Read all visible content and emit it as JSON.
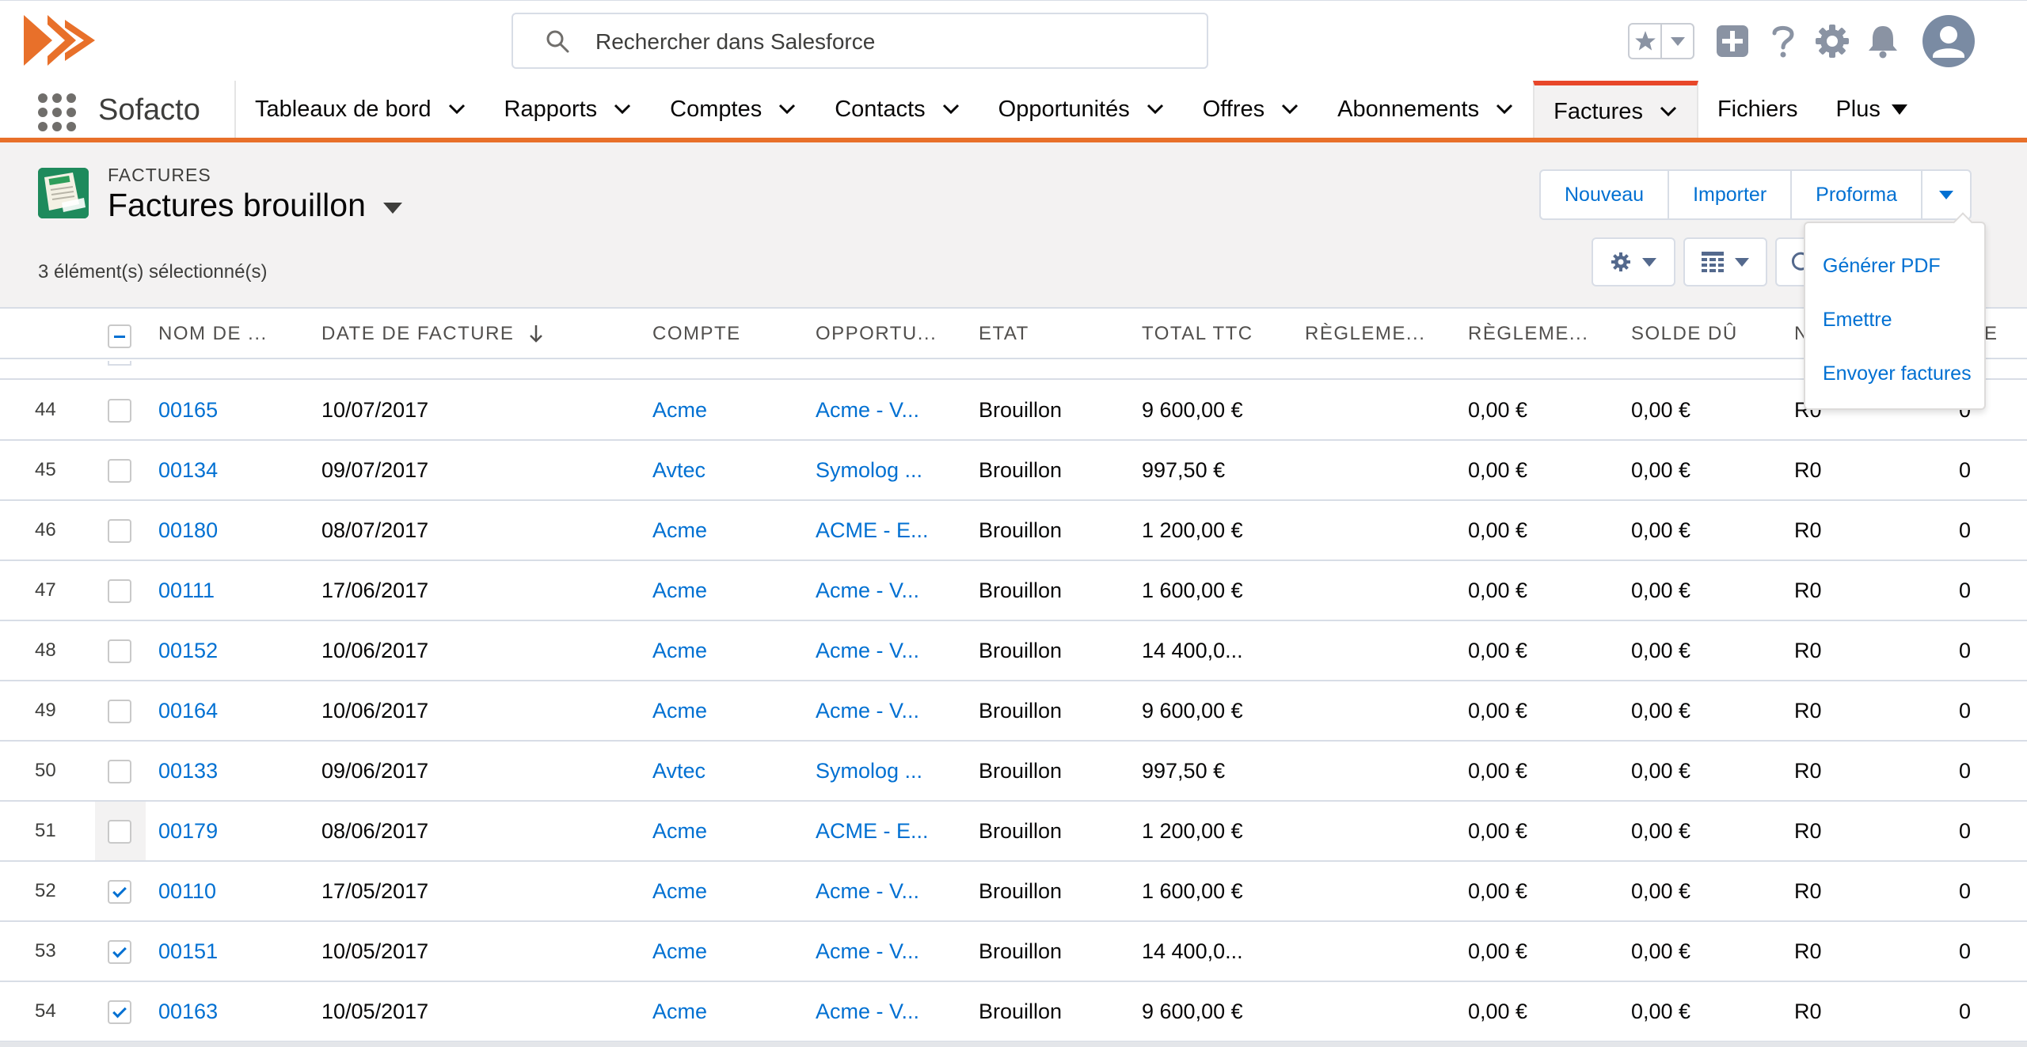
{
  "header": {
    "search_placeholder": "Rechercher dans Salesforce"
  },
  "nav": {
    "app_name": "Sofacto",
    "items": [
      {
        "label": "Tableaux de bord"
      },
      {
        "label": "Rapports"
      },
      {
        "label": "Comptes"
      },
      {
        "label": "Contacts"
      },
      {
        "label": "Opportunités"
      },
      {
        "label": "Offres"
      },
      {
        "label": "Abonnements"
      },
      {
        "label": "Factures",
        "active": true
      },
      {
        "label": "Fichiers"
      },
      {
        "label": "Plus"
      }
    ]
  },
  "list_view": {
    "object_label": "FACTURES",
    "title": "Factures brouillon",
    "selected_count": "3 élément(s) sélectionné(s)",
    "buttons": {
      "new": "Nouveau",
      "import": "Importer",
      "proforma": "Proforma"
    }
  },
  "dropdown": {
    "items": [
      "Générer PDF",
      "Emettre",
      "Envoyer factures"
    ]
  },
  "table": {
    "columns": [
      "NOM DE ...",
      "DATE DE FACTURE",
      "COMPTE",
      "OPPORTU...",
      "ETAT",
      "TOTAL TTC",
      "RÈGLEME...",
      "RÈGLEME...",
      "SOLDE DÛ",
      "N",
      "E"
    ],
    "sort_column": "DATE DE FACTURE",
    "rows": [
      {
        "n": "44",
        "checked": false,
        "nom": "00165",
        "date": "10/07/2017",
        "compte": "Acme",
        "opp": "Acme - V...",
        "etat": "Brouillon",
        "total": "9 600,00 €",
        "reg1": "",
        "reg2": "0,00 €",
        "solde": "0,00 €",
        "col_n": "R0",
        "col_e": "0"
      },
      {
        "n": "45",
        "checked": false,
        "nom": "00134",
        "date": "09/07/2017",
        "compte": "Avtec",
        "opp": "Symolog ...",
        "etat": "Brouillon",
        "total": "997,50 €",
        "reg1": "",
        "reg2": "0,00 €",
        "solde": "0,00 €",
        "col_n": "R0",
        "col_e": "0"
      },
      {
        "n": "46",
        "checked": false,
        "nom": "00180",
        "date": "08/07/2017",
        "compte": "Acme",
        "opp": "ACME - E...",
        "etat": "Brouillon",
        "total": "1 200,00 €",
        "reg1": "",
        "reg2": "0,00 €",
        "solde": "0,00 €",
        "col_n": "R0",
        "col_e": "0"
      },
      {
        "n": "47",
        "checked": false,
        "nom": "00111",
        "date": "17/06/2017",
        "compte": "Acme",
        "opp": "Acme - V...",
        "etat": "Brouillon",
        "total": "1 600,00 €",
        "reg1": "",
        "reg2": "0,00 €",
        "solde": "0,00 €",
        "col_n": "R0",
        "col_e": "0"
      },
      {
        "n": "48",
        "checked": false,
        "nom": "00152",
        "date": "10/06/2017",
        "compte": "Acme",
        "opp": "Acme - V...",
        "etat": "Brouillon",
        "total": "14 400,0...",
        "reg1": "",
        "reg2": "0,00 €",
        "solde": "0,00 €",
        "col_n": "R0",
        "col_e": "0"
      },
      {
        "n": "49",
        "checked": false,
        "nom": "00164",
        "date": "10/06/2017",
        "compte": "Acme",
        "opp": "Acme - V...",
        "etat": "Brouillon",
        "total": "9 600,00 €",
        "reg1": "",
        "reg2": "0,00 €",
        "solde": "0,00 €",
        "col_n": "R0",
        "col_e": "0"
      },
      {
        "n": "50",
        "checked": false,
        "nom": "00133",
        "date": "09/06/2017",
        "compte": "Avtec",
        "opp": "Symolog ...",
        "etat": "Brouillon",
        "total": "997,50 €",
        "reg1": "",
        "reg2": "0,00 €",
        "solde": "0,00 €",
        "col_n": "R0",
        "col_e": "0"
      },
      {
        "n": "51",
        "checked": false,
        "hover": true,
        "nom": "00179",
        "date": "08/06/2017",
        "compte": "Acme",
        "opp": "ACME - E...",
        "etat": "Brouillon",
        "total": "1 200,00 €",
        "reg1": "",
        "reg2": "0,00 €",
        "solde": "0,00 €",
        "col_n": "R0",
        "col_e": "0"
      },
      {
        "n": "52",
        "checked": true,
        "nom": "00110",
        "date": "17/05/2017",
        "compte": "Acme",
        "opp": "Acme - V...",
        "etat": "Brouillon",
        "total": "1 600,00 €",
        "reg1": "",
        "reg2": "0,00 €",
        "solde": "0,00 €",
        "col_n": "R0",
        "col_e": "0"
      },
      {
        "n": "53",
        "checked": true,
        "nom": "00151",
        "date": "10/05/2017",
        "compte": "Acme",
        "opp": "Acme - V...",
        "etat": "Brouillon",
        "total": "14 400,0...",
        "reg1": "",
        "reg2": "0,00 €",
        "solde": "0,00 €",
        "col_n": "R0",
        "col_e": "0"
      },
      {
        "n": "54",
        "checked": true,
        "nom": "00163",
        "date": "10/05/2017",
        "compte": "Acme",
        "opp": "Acme - V...",
        "etat": "Brouillon",
        "total": "9 600,00 €",
        "reg1": "",
        "reg2": "0,00 €",
        "solde": "0,00 €",
        "col_n": "R0",
        "col_e": "0"
      }
    ]
  },
  "colors": {
    "brand_orange": "#e8702a",
    "link_blue": "#0070d2",
    "object_icon_green": "#1e8a5c"
  }
}
